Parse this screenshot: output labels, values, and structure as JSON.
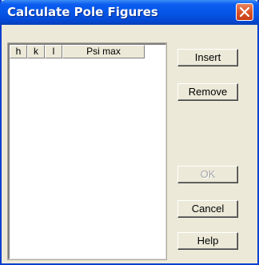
{
  "window": {
    "title": "Calculate Pole Figures"
  },
  "list": {
    "columns": [
      "h",
      "k",
      "l",
      "Psi max"
    ],
    "rows": []
  },
  "buttons": {
    "insert": "Insert",
    "remove": "Remove",
    "ok": "OK",
    "ok_enabled": false,
    "cancel": "Cancel",
    "help": "Help"
  },
  "icons": {
    "close": "close-icon"
  },
  "colors": {
    "titlebar": "#0555e6",
    "close": "#d9542a",
    "dialog_bg": "#ece9d8"
  }
}
